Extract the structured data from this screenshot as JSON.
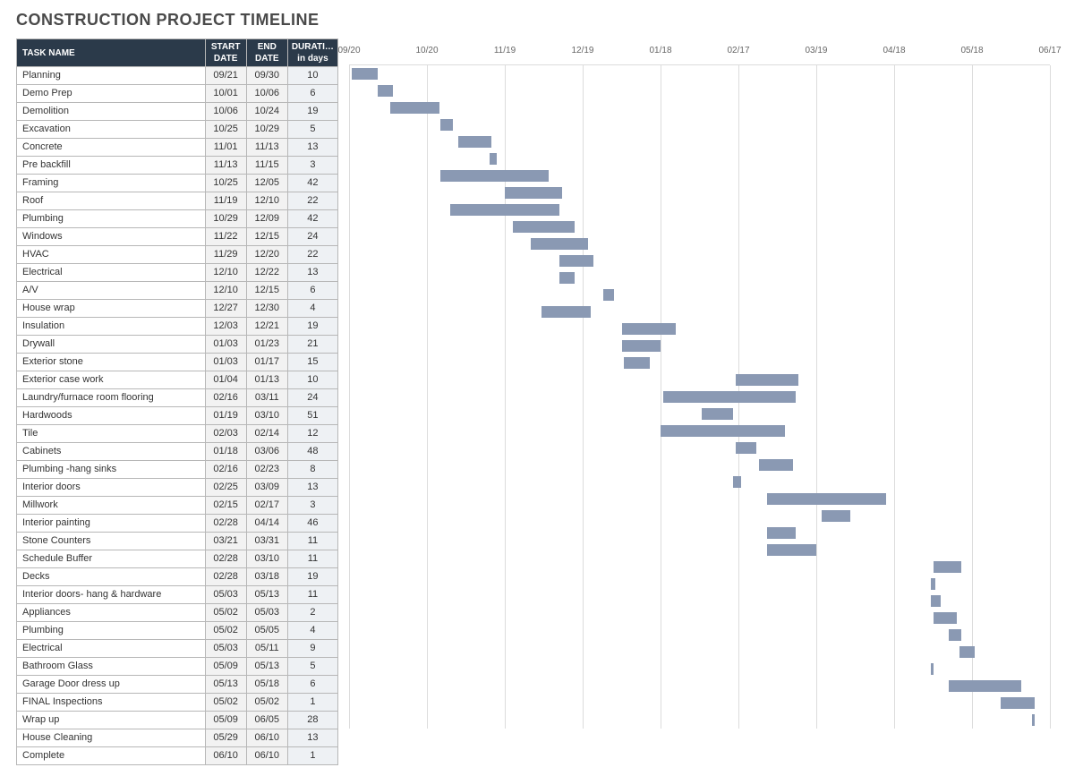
{
  "title": "CONSTRUCTION PROJECT TIMELINE",
  "columns": {
    "name": "TASK NAME",
    "start": "START DATE",
    "end": "END DATE",
    "duration": "DURATION in days"
  },
  "timeline": {
    "start_serial": 263,
    "end_serial": 533,
    "ticks": [
      {
        "label": "09/20",
        "serial": 263
      },
      {
        "label": "10/20",
        "serial": 293
      },
      {
        "label": "11/19",
        "serial": 323
      },
      {
        "label": "12/19",
        "serial": 353
      },
      {
        "label": "01/18",
        "serial": 383
      },
      {
        "label": "02/17",
        "serial": 413
      },
      {
        "label": "03/19",
        "serial": 443
      },
      {
        "label": "04/18",
        "serial": 473
      },
      {
        "label": "05/18",
        "serial": 503
      },
      {
        "label": "06/17",
        "serial": 533
      }
    ]
  },
  "tasks": [
    {
      "name": "Planning",
      "start": "09/21",
      "end": "09/30",
      "duration": "10",
      "s": 264,
      "e": 273
    },
    {
      "name": "Demo Prep",
      "start": "10/01",
      "end": "10/06",
      "duration": "6",
      "s": 274,
      "e": 279
    },
    {
      "name": "Demolition",
      "start": "10/06",
      "end": "10/24",
      "duration": "19",
      "s": 279,
      "e": 297
    },
    {
      "name": "Excavation",
      "start": "10/25",
      "end": "10/29",
      "duration": "5",
      "s": 298,
      "e": 302
    },
    {
      "name": "Concrete",
      "start": "11/01",
      "end": "11/13",
      "duration": "13",
      "s": 305,
      "e": 317
    },
    {
      "name": "Pre backfill",
      "start": "11/13",
      "end": "11/15",
      "duration": "3",
      "s": 317,
      "e": 319
    },
    {
      "name": "Framing",
      "start": "10/25",
      "end": "12/05",
      "duration": "42",
      "s": 298,
      "e": 339
    },
    {
      "name": "Roof",
      "start": "11/19",
      "end": "12/10",
      "duration": "22",
      "s": 323,
      "e": 344
    },
    {
      "name": "Plumbing",
      "start": "10/29",
      "end": "12/09",
      "duration": "42",
      "s": 302,
      "e": 343
    },
    {
      "name": "Windows",
      "start": "11/22",
      "end": "12/15",
      "duration": "24",
      "s": 326,
      "e": 349
    },
    {
      "name": "HVAC",
      "start": "11/29",
      "end": "12/20",
      "duration": "22",
      "s": 333,
      "e": 354
    },
    {
      "name": "Electrical",
      "start": "12/10",
      "end": "12/22",
      "duration": "13",
      "s": 344,
      "e": 356
    },
    {
      "name": "A/V",
      "start": "12/10",
      "end": "12/15",
      "duration": "6",
      "s": 344,
      "e": 349
    },
    {
      "name": "House wrap",
      "start": "12/27",
      "end": "12/30",
      "duration": "4",
      "s": 361,
      "e": 364
    },
    {
      "name": "Insulation",
      "start": "12/03",
      "end": "12/21",
      "duration": "19",
      "s": 337,
      "e": 355
    },
    {
      "name": "Drywall",
      "start": "01/03",
      "end": "01/23",
      "duration": "21",
      "s": 368,
      "e": 388
    },
    {
      "name": "Exterior stone",
      "start": "01/03",
      "end": "01/17",
      "duration": "15",
      "s": 368,
      "e": 382
    },
    {
      "name": "Exterior case work",
      "start": "01/04",
      "end": "01/13",
      "duration": "10",
      "s": 369,
      "e": 378
    },
    {
      "name": "Laundry/furnace room flooring",
      "start": "02/16",
      "end": "03/11",
      "duration": "24",
      "s": 412,
      "e": 435
    },
    {
      "name": "Hardwoods",
      "start": "01/19",
      "end": "03/10",
      "duration": "51",
      "s": 384,
      "e": 434
    },
    {
      "name": "Tile",
      "start": "02/03",
      "end": "02/14",
      "duration": "12",
      "s": 399,
      "e": 410
    },
    {
      "name": "Cabinets",
      "start": "01/18",
      "end": "03/06",
      "duration": "48",
      "s": 383,
      "e": 430
    },
    {
      "name": "Plumbing -hang sinks",
      "start": "02/16",
      "end": "02/23",
      "duration": "8",
      "s": 412,
      "e": 419
    },
    {
      "name": "Interior doors",
      "start": "02/25",
      "end": "03/09",
      "duration": "13",
      "s": 421,
      "e": 433
    },
    {
      "name": "Millwork",
      "start": "02/15",
      "end": "02/17",
      "duration": "3",
      "s": 411,
      "e": 413
    },
    {
      "name": "Interior painting",
      "start": "02/28",
      "end": "04/14",
      "duration": "46",
      "s": 424,
      "e": 469
    },
    {
      "name": "Stone Counters",
      "start": "03/21",
      "end": "03/31",
      "duration": "11",
      "s": 445,
      "e": 455
    },
    {
      "name": "Schedule Buffer",
      "start": "02/28",
      "end": "03/10",
      "duration": "11",
      "s": 424,
      "e": 434
    },
    {
      "name": "Decks",
      "start": "02/28",
      "end": "03/18",
      "duration": "19",
      "s": 424,
      "e": 442
    },
    {
      "name": "Interior doors- hang & hardware",
      "start": "05/03",
      "end": "05/13",
      "duration": "11",
      "s": 488,
      "e": 498
    },
    {
      "name": "Appliances",
      "start": "05/02",
      "end": "05/03",
      "duration": "2",
      "s": 487,
      "e": 488
    },
    {
      "name": "Plumbing",
      "start": "05/02",
      "end": "05/05",
      "duration": "4",
      "s": 487,
      "e": 490
    },
    {
      "name": "Electrical",
      "start": "05/03",
      "end": "05/11",
      "duration": "9",
      "s": 488,
      "e": 496
    },
    {
      "name": "Bathroom Glass",
      "start": "05/09",
      "end": "05/13",
      "duration": "5",
      "s": 494,
      "e": 498
    },
    {
      "name": "Garage Door dress up",
      "start": "05/13",
      "end": "05/18",
      "duration": "6",
      "s": 498,
      "e": 503
    },
    {
      "name": "FINAL Inspections",
      "start": "05/02",
      "end": "05/02",
      "duration": "1",
      "s": 487,
      "e": 487
    },
    {
      "name": "Wrap up",
      "start": "05/09",
      "end": "06/05",
      "duration": "28",
      "s": 494,
      "e": 521
    },
    {
      "name": "House Cleaning",
      "start": "05/29",
      "end": "06/10",
      "duration": "13",
      "s": 514,
      "e": 526
    },
    {
      "name": "Complete",
      "start": "06/10",
      "end": "06/10",
      "duration": "1",
      "s": 526,
      "e": 526
    }
  ],
  "chart_data": {
    "type": "bar",
    "title": "CONSTRUCTION PROJECT TIMELINE",
    "xlabel": "",
    "ylabel": "",
    "x_ticks": [
      "09/20",
      "10/20",
      "11/19",
      "12/19",
      "01/18",
      "02/17",
      "03/19",
      "04/18",
      "05/18",
      "06/17"
    ],
    "series": [
      {
        "name": "Planning",
        "start": "09/21",
        "end": "09/30",
        "duration_days": 10
      },
      {
        "name": "Demo Prep",
        "start": "10/01",
        "end": "10/06",
        "duration_days": 6
      },
      {
        "name": "Demolition",
        "start": "10/06",
        "end": "10/24",
        "duration_days": 19
      },
      {
        "name": "Excavation",
        "start": "10/25",
        "end": "10/29",
        "duration_days": 5
      },
      {
        "name": "Concrete",
        "start": "11/01",
        "end": "11/13",
        "duration_days": 13
      },
      {
        "name": "Pre backfill",
        "start": "11/13",
        "end": "11/15",
        "duration_days": 3
      },
      {
        "name": "Framing",
        "start": "10/25",
        "end": "12/05",
        "duration_days": 42
      },
      {
        "name": "Roof",
        "start": "11/19",
        "end": "12/10",
        "duration_days": 22
      },
      {
        "name": "Plumbing",
        "start": "10/29",
        "end": "12/09",
        "duration_days": 42
      },
      {
        "name": "Windows",
        "start": "11/22",
        "end": "12/15",
        "duration_days": 24
      },
      {
        "name": "HVAC",
        "start": "11/29",
        "end": "12/20",
        "duration_days": 22
      },
      {
        "name": "Electrical",
        "start": "12/10",
        "end": "12/22",
        "duration_days": 13
      },
      {
        "name": "A/V",
        "start": "12/10",
        "end": "12/15",
        "duration_days": 6
      },
      {
        "name": "House wrap",
        "start": "12/27",
        "end": "12/30",
        "duration_days": 4
      },
      {
        "name": "Insulation",
        "start": "12/03",
        "end": "12/21",
        "duration_days": 19
      },
      {
        "name": "Drywall",
        "start": "01/03",
        "end": "01/23",
        "duration_days": 21
      },
      {
        "name": "Exterior stone",
        "start": "01/03",
        "end": "01/17",
        "duration_days": 15
      },
      {
        "name": "Exterior case work",
        "start": "01/04",
        "end": "01/13",
        "duration_days": 10
      },
      {
        "name": "Laundry/furnace room flooring",
        "start": "02/16",
        "end": "03/11",
        "duration_days": 24
      },
      {
        "name": "Hardwoods",
        "start": "01/19",
        "end": "03/10",
        "duration_days": 51
      },
      {
        "name": "Tile",
        "start": "02/03",
        "end": "02/14",
        "duration_days": 12
      },
      {
        "name": "Cabinets",
        "start": "01/18",
        "end": "03/06",
        "duration_days": 48
      },
      {
        "name": "Plumbing -hang sinks",
        "start": "02/16",
        "end": "02/23",
        "duration_days": 8
      },
      {
        "name": "Interior doors",
        "start": "02/25",
        "end": "03/09",
        "duration_days": 13
      },
      {
        "name": "Millwork",
        "start": "02/15",
        "end": "02/17",
        "duration_days": 3
      },
      {
        "name": "Interior painting",
        "start": "02/28",
        "end": "04/14",
        "duration_days": 46
      },
      {
        "name": "Stone Counters",
        "start": "03/21",
        "end": "03/31",
        "duration_days": 11
      },
      {
        "name": "Schedule Buffer",
        "start": "02/28",
        "end": "03/10",
        "duration_days": 11
      },
      {
        "name": "Decks",
        "start": "02/28",
        "end": "03/18",
        "duration_days": 19
      },
      {
        "name": "Interior doors- hang & hardware",
        "start": "05/03",
        "end": "05/13",
        "duration_days": 11
      },
      {
        "name": "Appliances",
        "start": "05/02",
        "end": "05/03",
        "duration_days": 2
      },
      {
        "name": "Plumbing",
        "start": "05/02",
        "end": "05/05",
        "duration_days": 4
      },
      {
        "name": "Electrical",
        "start": "05/03",
        "end": "05/11",
        "duration_days": 9
      },
      {
        "name": "Bathroom Glass",
        "start": "05/09",
        "end": "05/13",
        "duration_days": 5
      },
      {
        "name": "Garage Door dress up",
        "start": "05/13",
        "end": "05/18",
        "duration_days": 6
      },
      {
        "name": "FINAL Inspections",
        "start": "05/02",
        "end": "05/02",
        "duration_days": 1
      },
      {
        "name": "Wrap up",
        "start": "05/09",
        "end": "06/05",
        "duration_days": 28
      },
      {
        "name": "House Cleaning",
        "start": "05/29",
        "end": "06/10",
        "duration_days": 13
      },
      {
        "name": "Complete",
        "start": "06/10",
        "end": "06/10",
        "duration_days": 1
      }
    ]
  }
}
